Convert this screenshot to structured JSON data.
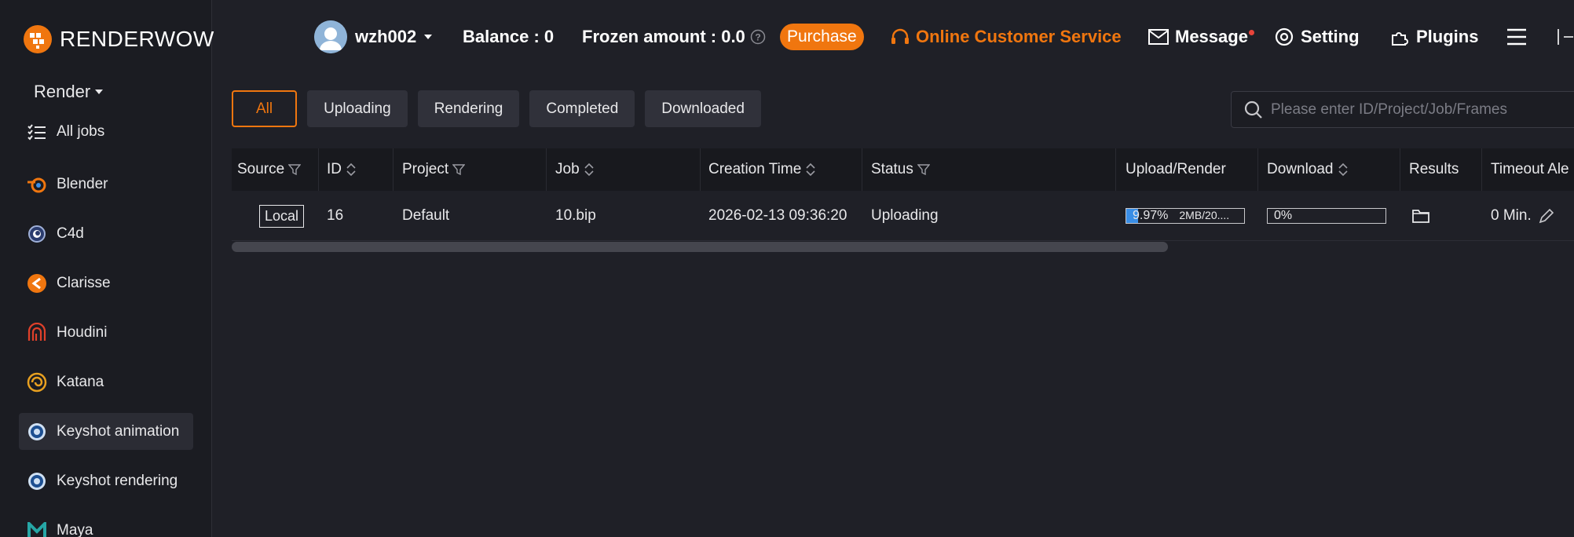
{
  "app": {
    "logo_text": "RENDERWOW"
  },
  "sidebar": {
    "section_label": "Render",
    "items": [
      {
        "label": "All jobs",
        "icon": "list-icon"
      },
      {
        "label": "Blender",
        "icon": "blender-icon"
      },
      {
        "label": "C4d",
        "icon": "c4d-icon"
      },
      {
        "label": "Clarisse",
        "icon": "clarisse-icon"
      },
      {
        "label": "Houdini",
        "icon": "houdini-icon"
      },
      {
        "label": "Katana",
        "icon": "katana-icon"
      },
      {
        "label": "Keyshot animation",
        "icon": "keyshot-icon",
        "active": true
      },
      {
        "label": "Keyshot rendering",
        "icon": "keyshot-icon"
      },
      {
        "label": "Maya",
        "icon": "maya-icon"
      }
    ]
  },
  "header": {
    "username": "wzh002",
    "balance": "Balance : 0",
    "frozen": "Frozen amount : 0.0",
    "purchase": "Purchase",
    "service": "Online Customer Service",
    "message": "Message",
    "setting": "Setting",
    "plugins": "Plugins"
  },
  "filters": {
    "tabs": [
      "All",
      "Uploading",
      "Rendering",
      "Completed",
      "Downloaded"
    ],
    "active": "All",
    "search_placeholder": "Please enter ID/Project/Job/Frames"
  },
  "table": {
    "columns": [
      "Source",
      "ID",
      "Project",
      "Job",
      "Creation Time",
      "Status",
      "Upload/Render",
      "Download",
      "Results",
      "Timeout Ale"
    ],
    "rows": [
      {
        "source": "Local",
        "id": "16",
        "project": "Default",
        "job": "10.bip",
        "creation_time": "2026-02-13 09:36:20",
        "status": "Uploading",
        "upload_pct_label": "9.97%",
        "upload_pct": 0.0997,
        "upload_size": "2MB/20....",
        "download_pct_label": "0%",
        "download_pct": 0,
        "timeout": "0 Min."
      }
    ]
  },
  "colors": {
    "accent": "#f0760f",
    "progress": "#3a8ee6",
    "background": "#1f2027"
  }
}
